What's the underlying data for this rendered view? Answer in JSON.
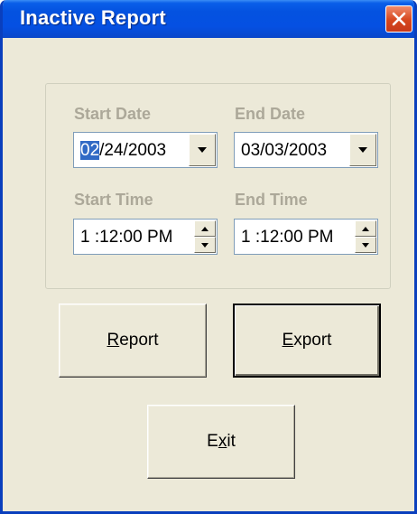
{
  "window": {
    "title": "Inactive Report"
  },
  "start_date": {
    "label": "Start Date",
    "selected_part": "02",
    "rest": "/24/2003"
  },
  "end_date": {
    "label": "End Date",
    "value": "03/03/2003"
  },
  "start_time": {
    "label": "Start Time",
    "value": "1 :12:00 PM"
  },
  "end_time": {
    "label": "End Time",
    "value": "1 :12:00 PM"
  },
  "buttons": {
    "report": {
      "mnemonic": "R",
      "rest": "eport"
    },
    "export": {
      "mnemonic": "E",
      "rest": "xport"
    },
    "exit": {
      "pre": "E",
      "mnemonic": "x",
      "rest": "it"
    }
  }
}
